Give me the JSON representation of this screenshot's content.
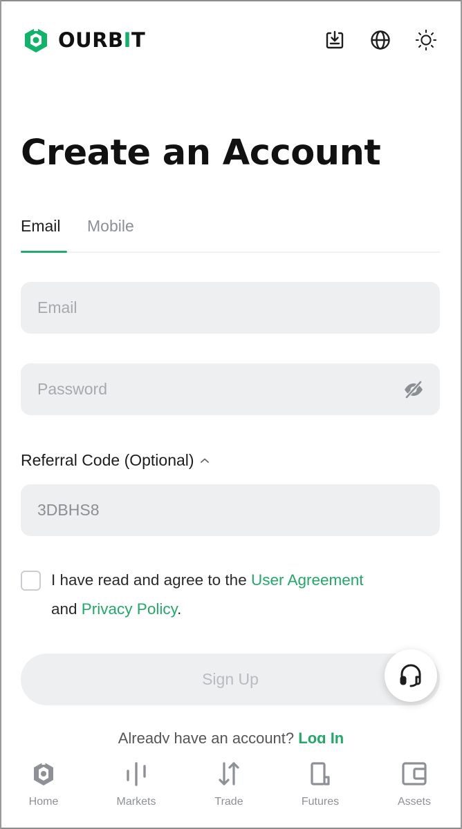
{
  "header": {
    "brand_prefix": "OURB",
    "brand_accent": "I",
    "brand_suffix": "T",
    "icons": [
      "download-icon",
      "globe-icon",
      "sun-icon"
    ]
  },
  "page": {
    "title": "Create an Account"
  },
  "tabs": [
    {
      "label": "Email",
      "active": true
    },
    {
      "label": "Mobile",
      "active": false
    }
  ],
  "form": {
    "email_placeholder": "Email",
    "password_placeholder": "Password",
    "referral_label": "Referral Code (Optional)",
    "referral_value": "3DBHS8",
    "agree_prefix": "I have read and agree to the ",
    "user_agreement": "User Agreement",
    "agree_and": "and ",
    "privacy_policy": "Privacy Policy",
    "agree_end": ".",
    "signup_label": "Sign Up",
    "login_prompt": "Already have an account?",
    "login_link": "Log In"
  },
  "bottom_nav": [
    {
      "label": "Home",
      "icon": "home-icon"
    },
    {
      "label": "Markets",
      "icon": "markets-icon"
    },
    {
      "label": "Trade",
      "icon": "trade-icon"
    },
    {
      "label": "Futures",
      "icon": "futures-icon"
    },
    {
      "label": "Assets",
      "icon": "assets-icon"
    }
  ],
  "colors": {
    "accent": "#1fae6b",
    "link": "#22a868",
    "field_bg": "#eeeff1"
  }
}
